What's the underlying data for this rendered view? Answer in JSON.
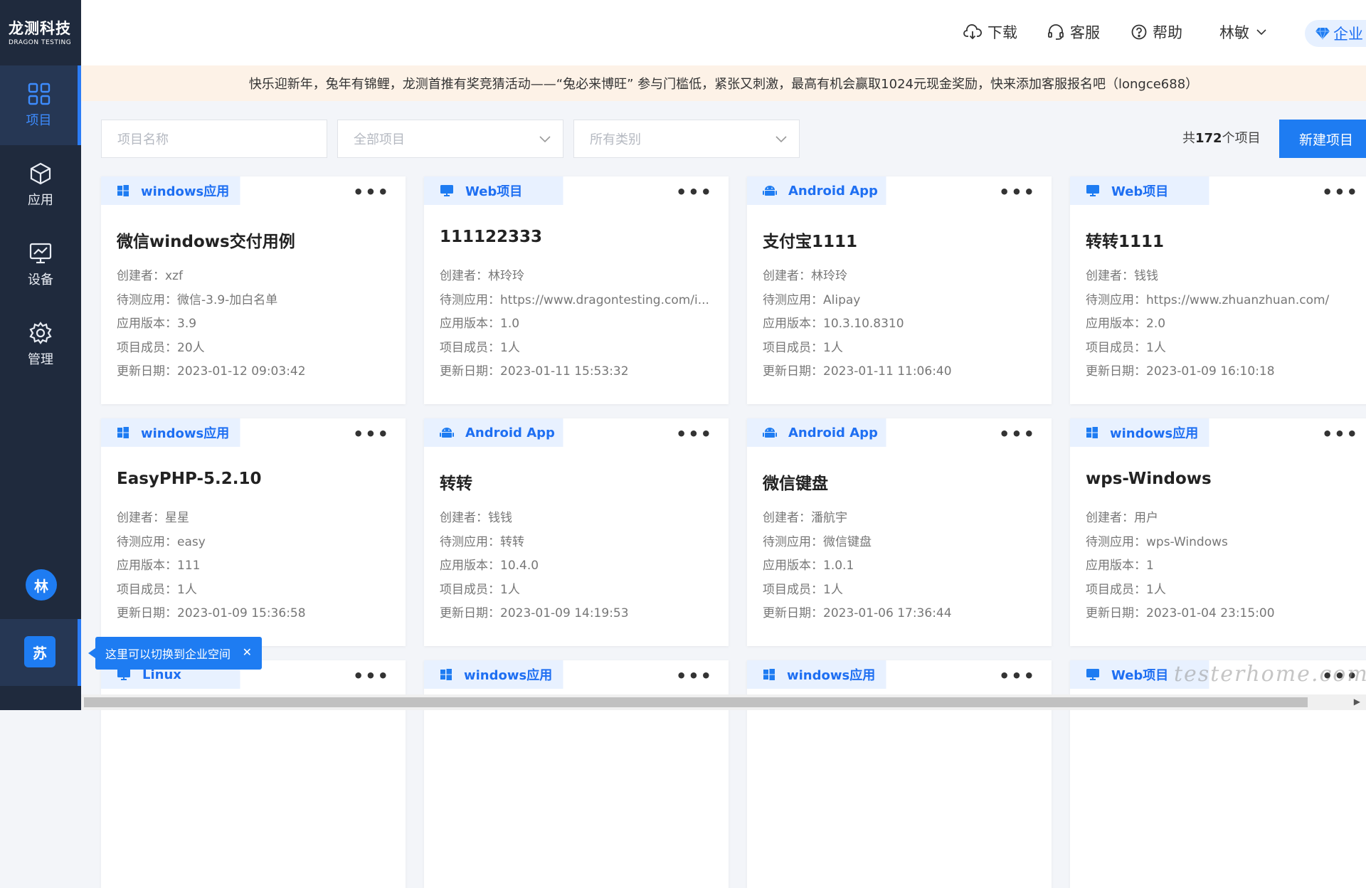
{
  "brand": {
    "name_cn": "龙测科技",
    "name_en": "DRAGON TESTING"
  },
  "sidebar": {
    "items": [
      {
        "label": "项目",
        "icon": "grid-icon",
        "active": true
      },
      {
        "label": "应用",
        "icon": "cube-icon",
        "active": false
      },
      {
        "label": "设备",
        "icon": "monitor-icon",
        "active": false
      },
      {
        "label": "管理",
        "icon": "gear-icon",
        "active": false
      }
    ],
    "user_avatar": "林",
    "space_avatar": "苏"
  },
  "header": {
    "download": "下载",
    "service": "客服",
    "help": "帮助",
    "user": "林敏",
    "enterprise": "企业"
  },
  "notice": "快乐迎新年，兔年有锦鲤，龙测首推有奖竞猜活动——“兔必来博旺” 参与门槛低，紧张又刺激，最高有机会赢取1024元现金奖励，快来添加客服报名吧（longce688）",
  "filters": {
    "name_placeholder": "项目名称",
    "scope": "全部项目",
    "category": "所有类别"
  },
  "total": {
    "prefix": "共",
    "count": "172",
    "suffix": "个项目"
  },
  "new_project_label": "新建项目",
  "labels": {
    "creator": "创建者：",
    "app": "待测应用：",
    "version": "应用版本：",
    "members": "项目成员：",
    "updated": "更新日期："
  },
  "projects": [
    {
      "type": "windows应用",
      "icon": "windows-icon",
      "title": "微信windows交付用例",
      "creator": "xzf",
      "app": "微信-3.9-加白名单",
      "version": "3.9",
      "members": "20人",
      "updated": "2023-01-12 09:03:42"
    },
    {
      "type": "Web项目",
      "icon": "monitor-icon",
      "title": "111122333",
      "creator": "林玲玲",
      "app": "https://www.dragontesting.com/i...",
      "version": "1.0",
      "members": "1人",
      "updated": "2023-01-11 15:53:32"
    },
    {
      "type": "Android App",
      "icon": "android-icon",
      "title": "支付宝1111",
      "creator": "林玲玲",
      "app": "Alipay",
      "version": "10.3.10.8310",
      "members": "1人",
      "updated": "2023-01-11 11:06:40"
    },
    {
      "type": "Web项目",
      "icon": "monitor-icon",
      "title": "转转1111",
      "creator": "钱钱",
      "app": "https://www.zhuanzhuan.com/",
      "version": "2.0",
      "members": "1人",
      "updated": "2023-01-09 16:10:18"
    },
    {
      "type": "windows应用",
      "icon": "windows-icon",
      "title": "EasyPHP-5.2.10",
      "creator": "星星",
      "app": "easy",
      "version": "111",
      "members": "1人",
      "updated": "2023-01-09 15:36:58"
    },
    {
      "type": "Android App",
      "icon": "android-icon",
      "title": "转转",
      "creator": "钱钱",
      "app": "转转",
      "version": "10.4.0",
      "members": "1人",
      "updated": "2023-01-09 14:19:53"
    },
    {
      "type": "Android App",
      "icon": "android-icon",
      "title": "微信键盘",
      "creator": "潘航宇",
      "app": "微信键盘",
      "version": "1.0.1",
      "members": "1人",
      "updated": "2023-01-06 17:36:44"
    },
    {
      "type": "windows应用",
      "icon": "windows-icon",
      "title": "wps-Windows",
      "creator": "用户",
      "app": "wps-Windows",
      "version": "1",
      "members": "1人",
      "updated": "2023-01-04 23:15:00"
    },
    {
      "type": "Linux",
      "icon": "linux-icon"
    },
    {
      "type": "windows应用",
      "icon": "windows-icon"
    },
    {
      "type": "windows应用",
      "icon": "windows-icon"
    },
    {
      "type": "Web项目",
      "icon": "monitor-icon"
    }
  ],
  "tooltip": "这里可以切换到企业空间",
  "watermark": "testerhome.com",
  "colors": {
    "primary": "#1e7cf2",
    "sidebar": "#1f2a3d",
    "notice_bg": "#fdf2e7"
  }
}
